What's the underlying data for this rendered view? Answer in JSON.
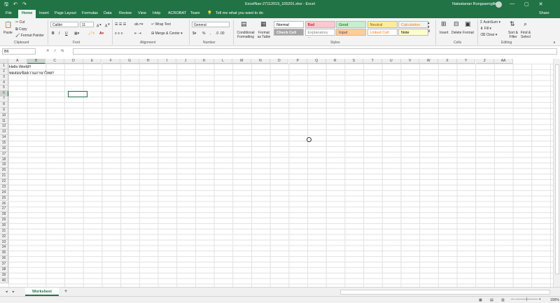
{
  "titlebar": {
    "title": "ExcelNav-27112019_105201.xlsx  -  Excel",
    "user": "Natsatanan Rungsaenglikit",
    "qa_icons": [
      "save-icon",
      "undo-icon",
      "redo-icon"
    ],
    "window_buttons": [
      "—",
      "▢",
      "✕"
    ]
  },
  "tabs": [
    "File",
    "Home",
    "Insert",
    "Page Layout",
    "Formulas",
    "Data",
    "Review",
    "View",
    "Help",
    "ACROBAT",
    "Team"
  ],
  "tell_me": "Tell me what you want to do",
  "share": "Share",
  "ribbon": {
    "clipboard": {
      "paste": "Paste",
      "cut": "Cut",
      "copy": "Copy",
      "format_painter": "Format Painter",
      "label": "Clipboard"
    },
    "font": {
      "name": "Calibri",
      "size": "11",
      "label": "Font",
      "bold": "B",
      "italic": "I",
      "underline": "U"
    },
    "alignment": {
      "wrap": "Wrap Text",
      "merge": "Merge & Center",
      "label": "Alignment"
    },
    "number": {
      "format": "General",
      "label": "Number",
      "percent": "%"
    },
    "styles": {
      "conditional": "Conditional Formatting",
      "format_table": "Format as Table",
      "label": "Styles",
      "cells": [
        {
          "label": "Normal",
          "bg": "#ffffff",
          "fg": "#000000"
        },
        {
          "label": "Bad",
          "bg": "#ffc7ce",
          "fg": "#9c0006"
        },
        {
          "label": "Good",
          "bg": "#c6efce",
          "fg": "#006100"
        },
        {
          "label": "Neutral",
          "bg": "#ffeb9c",
          "fg": "#9c5700"
        },
        {
          "label": "Calculation",
          "bg": "#f2f2f2",
          "fg": "#fa7d00"
        },
        {
          "label": "Check Cell",
          "bg": "#a5a5a5",
          "fg": "#ffffff"
        },
        {
          "label": "Explanatory ...",
          "bg": "#ffffff",
          "fg": "#7f7f7f"
        },
        {
          "label": "Input",
          "bg": "#ffcc99",
          "fg": "#3f3f76"
        },
        {
          "label": "Linked Cell",
          "bg": "#ffffff",
          "fg": "#fa7d00"
        },
        {
          "label": "Note",
          "bg": "#ffffcc",
          "fg": "#000000"
        }
      ]
    },
    "cells": {
      "insert": "Insert",
      "delete": "Delete",
      "format": "Format",
      "label": "Cells"
    },
    "editing": {
      "autosum": "AutoSum",
      "fill": "Fill",
      "clear": "Clear",
      "sort": "Sort & Filter",
      "find": "Find & Select",
      "label": "Editing"
    }
  },
  "formula_bar": {
    "name_box": "B6",
    "fx": "fx",
    "value": ""
  },
  "columns": [
    "A",
    "B",
    "C",
    "D",
    "E",
    "F",
    "G",
    "H",
    "I",
    "J",
    "K",
    "L",
    "M",
    "N",
    "O",
    "P",
    "Q",
    "R",
    "S",
    "T",
    "U",
    "V",
    "W",
    "X",
    "Y",
    "Z",
    "AA"
  ],
  "rows": [
    "1",
    "2",
    "3",
    "4",
    "5",
    "6",
    "7",
    "8",
    "9",
    "10",
    "11",
    "12",
    "13",
    "14",
    "15",
    "16",
    "17",
    "18",
    "19",
    "20",
    "21",
    "22",
    "23",
    "24",
    "25",
    "26",
    "27",
    "28",
    "29",
    "30",
    "31",
    "32",
    "33",
    "34",
    "35",
    "36",
    "37",
    "38",
    "39",
    "40"
  ],
  "cell_values": {
    "A1": "Hello World!!",
    "A2": "ทดสอบข้อความภาษาไทย!!"
  },
  "sheet": {
    "tab": "Worksheet",
    "add": "+"
  },
  "status": {
    "zoom": "100%"
  }
}
